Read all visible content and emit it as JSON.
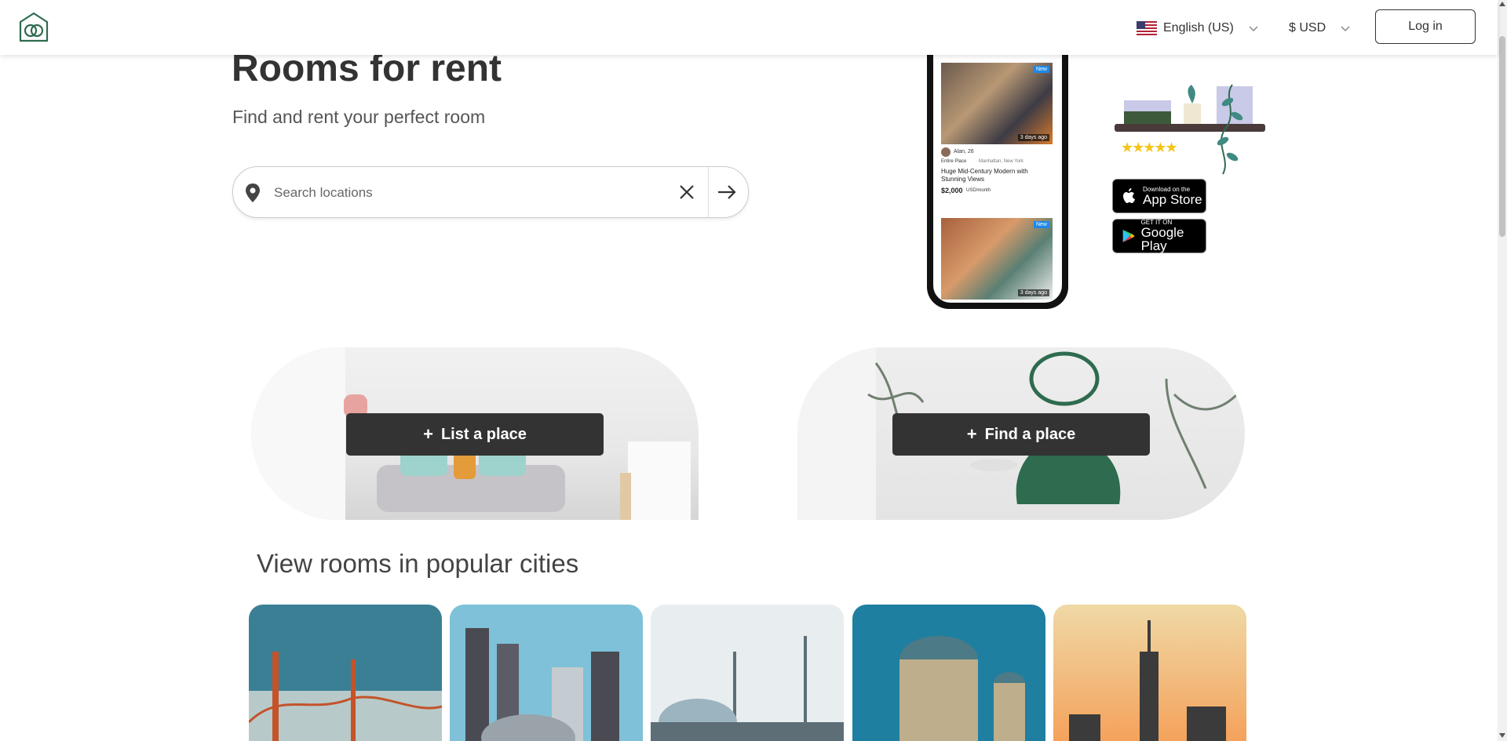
{
  "header": {
    "language_label": "English (US)",
    "currency_label": "$ USD",
    "login_label": "Log in"
  },
  "hero": {
    "title": "Rooms for rent",
    "subtitle": "Find and rent your perfect room"
  },
  "search": {
    "placeholder": "Search locations"
  },
  "phone_mockup": {
    "user": "Alan, 26",
    "place_type": "Entire Place",
    "location": "Manhattan, New York",
    "listing_title": "Huge Mid-Century Modern  with Stunning Views",
    "price": "$2,000",
    "price_unit": "USD/month",
    "badge": "New",
    "ago_1": "3 days ago",
    "ago_2": "3 days ago"
  },
  "app_stores": {
    "apple_small": "Download on the",
    "apple_big": "App Store",
    "google_small": "GET IT ON",
    "google_big": "Google Play"
  },
  "rating": "★★★★★",
  "cards": {
    "list_label": "List a place",
    "find_label": "Find a place"
  },
  "popular": {
    "title": "View rooms in popular cities",
    "cities": [
      {
        "colors": [
          "#3a7f94",
          "#b8c9c9",
          "#c4532a"
        ]
      },
      {
        "colors": [
          "#7ec1d8",
          "#4a4a52",
          "#c5ccd1"
        ]
      },
      {
        "colors": [
          "#e8eef0",
          "#9bb4bf",
          "#5d6e76"
        ]
      },
      {
        "colors": [
          "#1f7fa0",
          "#4c7a86",
          "#bfae8b"
        ]
      },
      {
        "colors": [
          "#f0d9a6",
          "#f4a25b",
          "#3b3b3b"
        ]
      }
    ]
  },
  "colors": {
    "brand_green": "#2e6b4f",
    "button_dark": "#333333",
    "text_dark": "#333333"
  }
}
